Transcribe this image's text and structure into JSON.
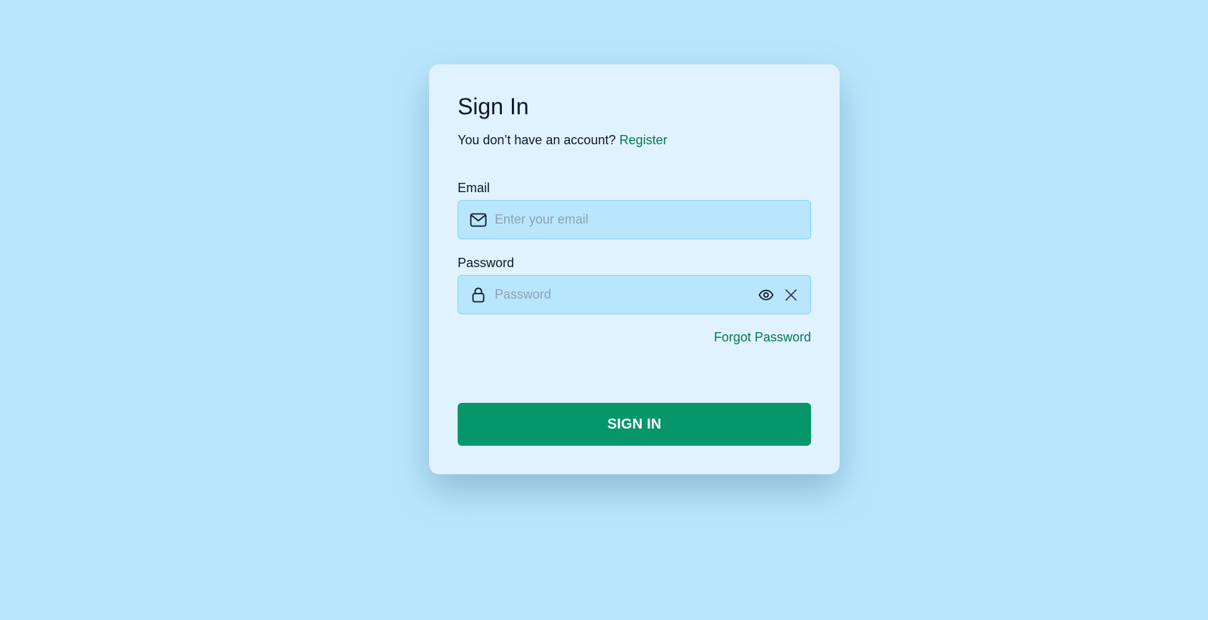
{
  "page": {
    "background_color": "#bae6fd"
  },
  "card": {
    "title": "Sign In",
    "subtitle_text": "You don’t have an account?",
    "register_link": "Register",
    "background_color": "#e0f2fe"
  },
  "form": {
    "email": {
      "label": "Email",
      "placeholder": "Enter your email",
      "value": "",
      "icon": "mail-icon"
    },
    "password": {
      "label": "Password",
      "placeholder": "Password",
      "value": "",
      "icon": "lock-icon",
      "toggle_icon": "eye-icon",
      "clear_icon": "close-icon"
    },
    "forgot_password": "Forgot Password",
    "submit_label": "SIGN IN"
  },
  "colors": {
    "accent": "#059669",
    "link": "#047857",
    "input_background": "#bae6fd",
    "input_border": "#7dd3fc"
  }
}
